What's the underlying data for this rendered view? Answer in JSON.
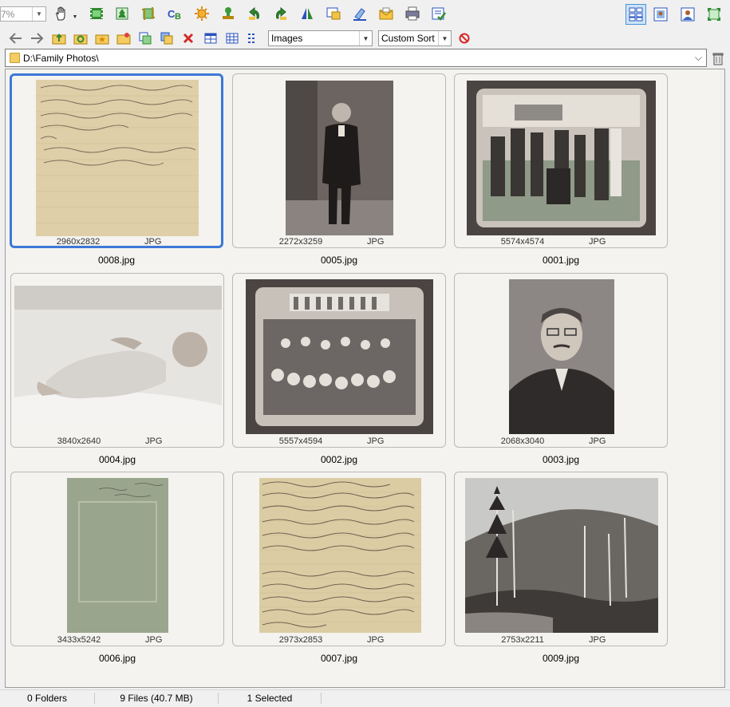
{
  "toolbar": {
    "zoom_value": "7%",
    "icons": [
      "hand-pan-icon",
      "filmstrip-icon",
      "tree-resize-icon",
      "crop-icon",
      "cb-icon",
      "brightness-icon",
      "stamp-icon",
      "rotate-left-icon",
      "rotate-right-icon",
      "flip-icon",
      "frame-icon",
      "eraser-icon",
      "envelope-icon",
      "print-icon",
      "checklist-icon"
    ],
    "view_icons": [
      "thumbnail-view-icon",
      "preview-view-icon",
      "person-view-icon",
      "fullscreen-icon"
    ]
  },
  "nav": {
    "filter_value": "Images",
    "sort_value": "Custom Sort"
  },
  "address": {
    "path": "D:\\Family Photos\\"
  },
  "files": [
    {
      "name": "0008.jpg",
      "dims": "2960x2832",
      "type": "JPG",
      "selected": true
    },
    {
      "name": "0005.jpg",
      "dims": "2272x3259",
      "type": "JPG",
      "selected": false
    },
    {
      "name": "0001.jpg",
      "dims": "5574x4574",
      "type": "JPG",
      "selected": false
    },
    {
      "name": "0004.jpg",
      "dims": "3840x2640",
      "type": "JPG",
      "selected": false
    },
    {
      "name": "0002.jpg",
      "dims": "5557x4594",
      "type": "JPG",
      "selected": false
    },
    {
      "name": "0003.jpg",
      "dims": "2068x3040",
      "type": "JPG",
      "selected": false
    },
    {
      "name": "0006.jpg",
      "dims": "3433x5242",
      "type": "JPG",
      "selected": false
    },
    {
      "name": "0007.jpg",
      "dims": "2973x2853",
      "type": "JPG",
      "selected": false
    },
    {
      "name": "0009.jpg",
      "dims": "2753x2211",
      "type": "JPG",
      "selected": false
    }
  ],
  "status": {
    "folders": "0 Folders",
    "files": "9 Files (40.7 MB)",
    "selected": "1 Selected"
  },
  "colors": {
    "selection": "#3c78d8",
    "tile_bg": "#f4f3ef"
  }
}
